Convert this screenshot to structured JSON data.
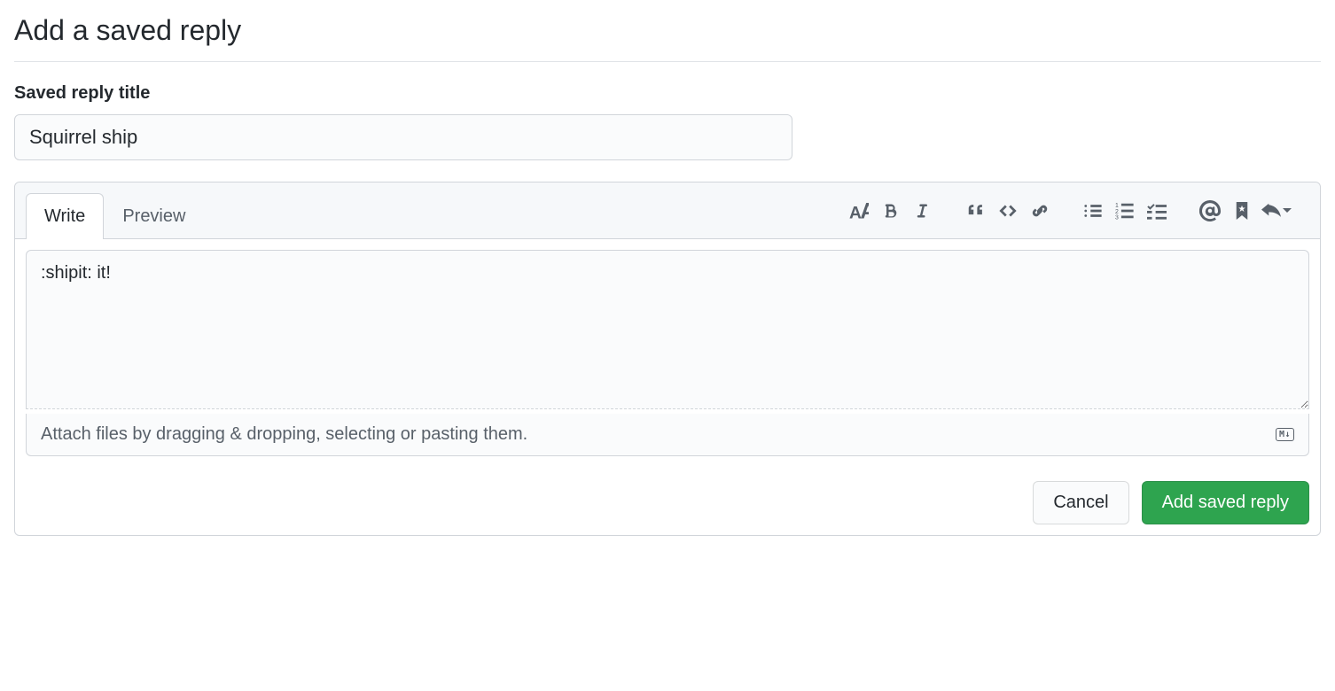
{
  "page": {
    "title": "Add a saved reply"
  },
  "form": {
    "title_label": "Saved reply title",
    "title_value": "Squirrel ship",
    "tabs": {
      "write": "Write",
      "preview": "Preview"
    },
    "body_value": ":shipit: it!",
    "attach_hint": "Attach files by dragging & dropping, selecting or pasting them.",
    "markdown_badge": "M↓"
  },
  "actions": {
    "cancel": "Cancel",
    "submit": "Add saved reply"
  }
}
